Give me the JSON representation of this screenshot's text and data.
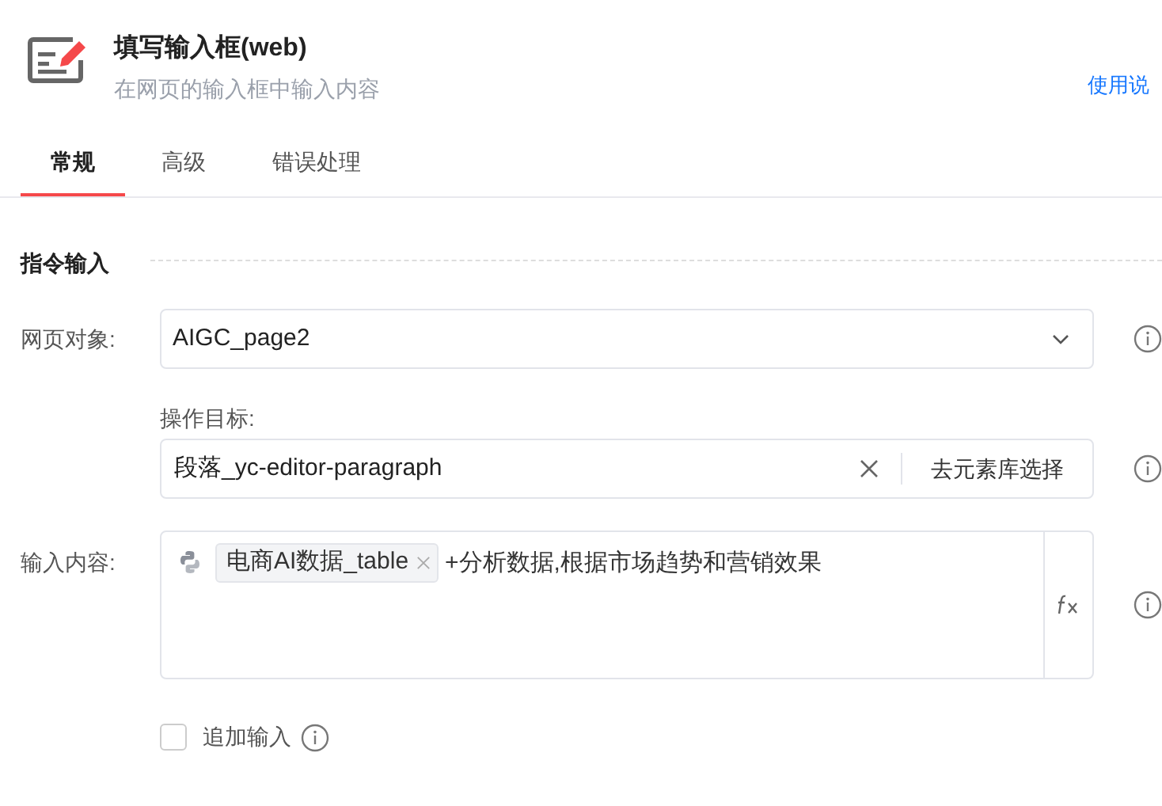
{
  "header": {
    "title": "填写输入框(web)",
    "subtitle": "在网页的输入框中输入内容",
    "help_link": "使用说"
  },
  "tabs": [
    {
      "label": "常规",
      "selected": true
    },
    {
      "label": "高级",
      "selected": false
    },
    {
      "label": "错误处理",
      "selected": false
    }
  ],
  "section": {
    "title": "指令输入"
  },
  "web_object": {
    "label": "网页对象:",
    "value": "AIGC_page2"
  },
  "target": {
    "label": "操作目标:",
    "value": "段落_yc-editor-paragraph",
    "button": "去元素库选择"
  },
  "content": {
    "label": "输入内容:",
    "variable": "电商AI数据_table",
    "text": "+分析数据,根据市场趋势和营销效果"
  },
  "append": {
    "label": "追加输入",
    "checked": false
  }
}
